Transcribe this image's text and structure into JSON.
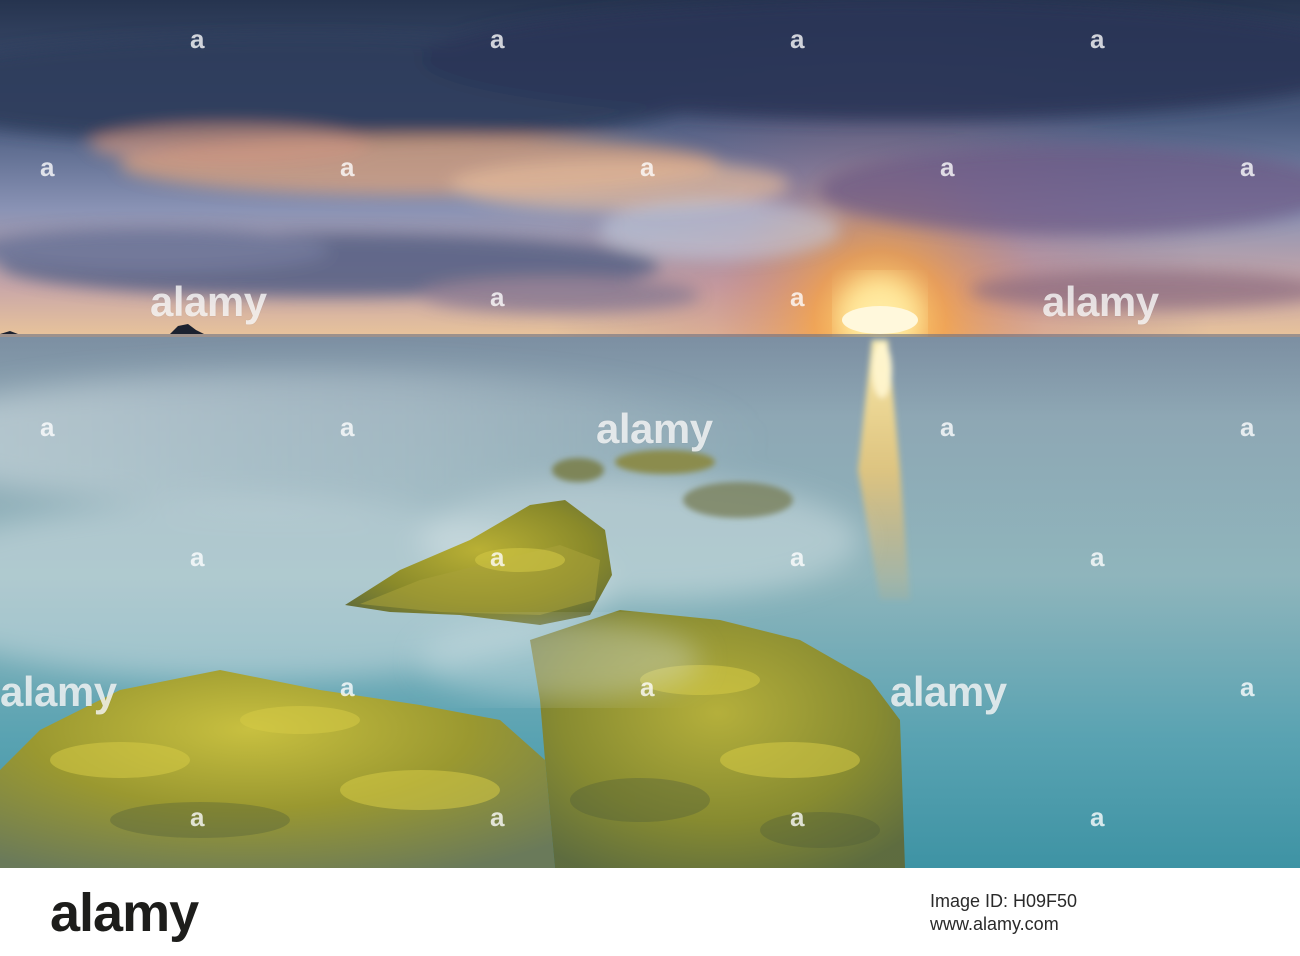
{
  "watermark": {
    "logo_text": "alamy",
    "mark_text": "a"
  },
  "footer": {
    "logo": "alamy",
    "image_id": "Image ID: H09F50",
    "website": "www.alamy.com"
  },
  "colors": {
    "sky_top": "#2c3b5a",
    "sky_mid": "#5b6e94",
    "sunset_orange": "#f8a23c",
    "sun_core": "#fff3c0",
    "sea": "#5fa6b3",
    "sea_deep": "#3e8fa0",
    "moss": "#a8a030"
  }
}
